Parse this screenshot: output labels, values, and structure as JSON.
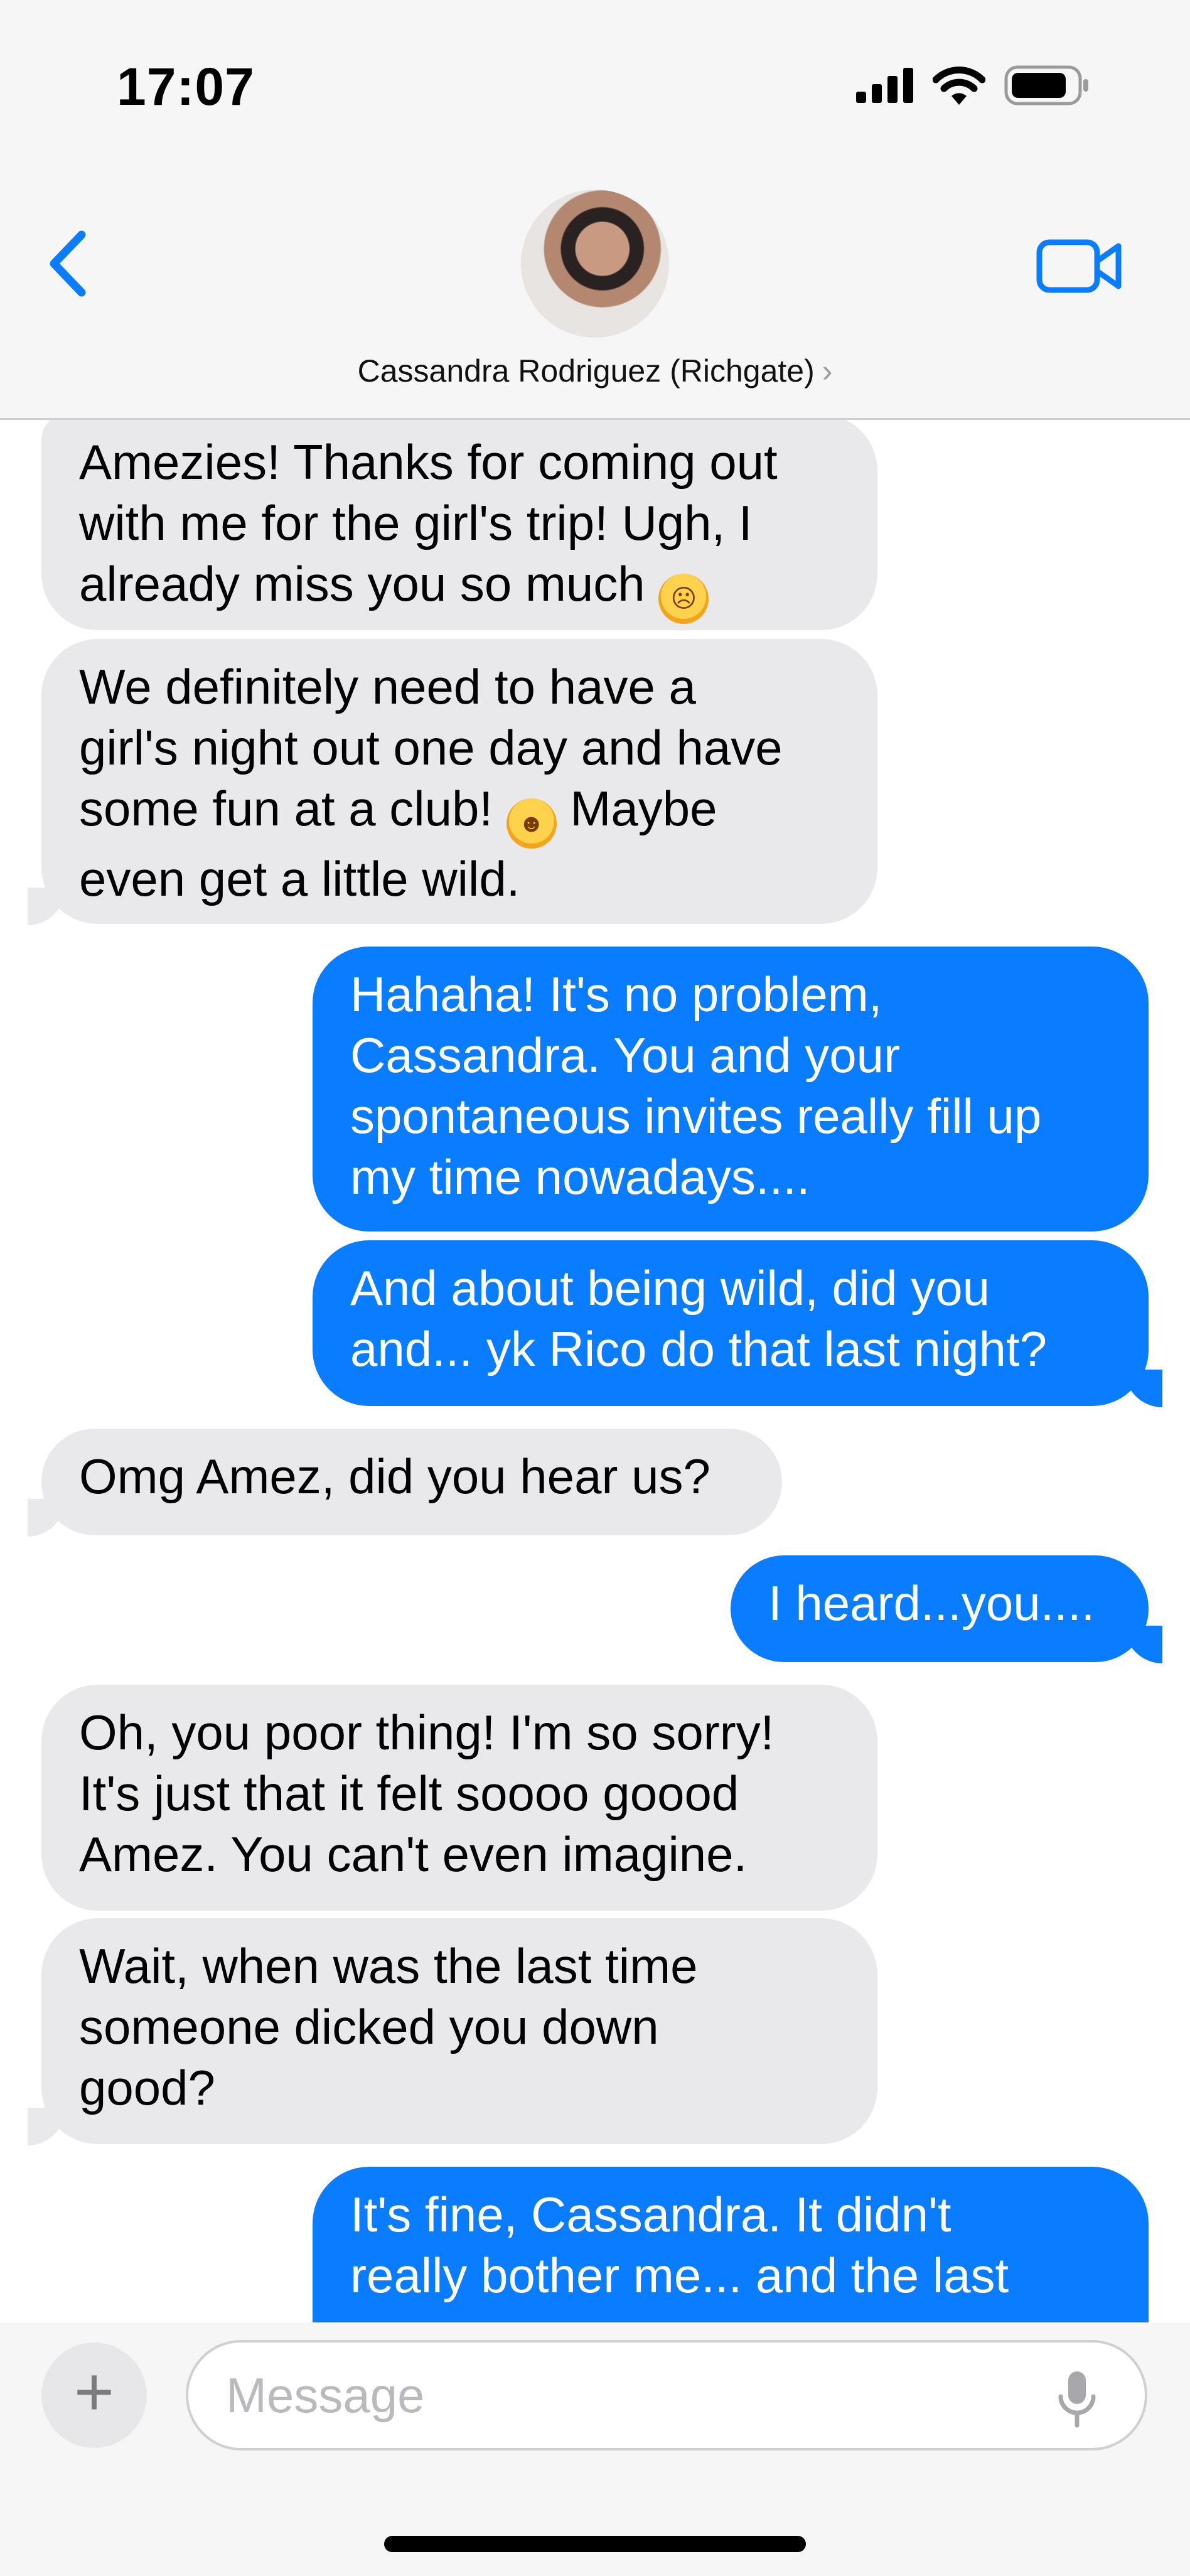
{
  "status_bar": {
    "time": "17:07"
  },
  "header": {
    "contact_name": "Cassandra Rodriguez (Richgate)",
    "chevron": "›"
  },
  "messages": [
    {
      "dir": "in",
      "lines": [
        "Amezies! Thanks for coming out",
        "with me for the girl's trip! Ugh, I",
        "already miss you so much"
      ],
      "emoji": "weary-face"
    },
    {
      "dir": "in",
      "lines": [
        "We definitely need to have a",
        "girl's night out one day and have",
        "some fun at a club!",
        "even get a little wild."
      ],
      "line3_tail": "Maybe",
      "emoji": "zany-face"
    },
    {
      "dir": "out",
      "lines": [
        "Hahaha! It's no problem,",
        "Cassandra. You and your",
        "spontaneous invites really fill up",
        "my time nowadays...."
      ]
    },
    {
      "dir": "out",
      "lines": [
        "And about being wild, did you",
        "and... yk Rico do that last night?"
      ]
    },
    {
      "dir": "in",
      "lines": [
        "Omg Amez, did you hear us?"
      ]
    },
    {
      "dir": "out",
      "lines": [
        "I heard...you...."
      ]
    },
    {
      "dir": "in",
      "lines": [
        "Oh, you poor thing! I'm so sorry!",
        "It's just that it felt soooo goood",
        "Amez. You can't even imagine."
      ]
    },
    {
      "dir": "in",
      "lines": [
        "Wait, when was the last time",
        "someone dicked you down",
        "good?"
      ]
    },
    {
      "dir": "out",
      "lines": [
        "It's fine, Cassandra. It didn't",
        "really bother me... and the last"
      ]
    }
  ],
  "composer": {
    "placeholder": "Message"
  },
  "colors": {
    "outgoing": "#0a7cff",
    "incoming": "#e9e9eb",
    "accent": "#0a7cff"
  }
}
